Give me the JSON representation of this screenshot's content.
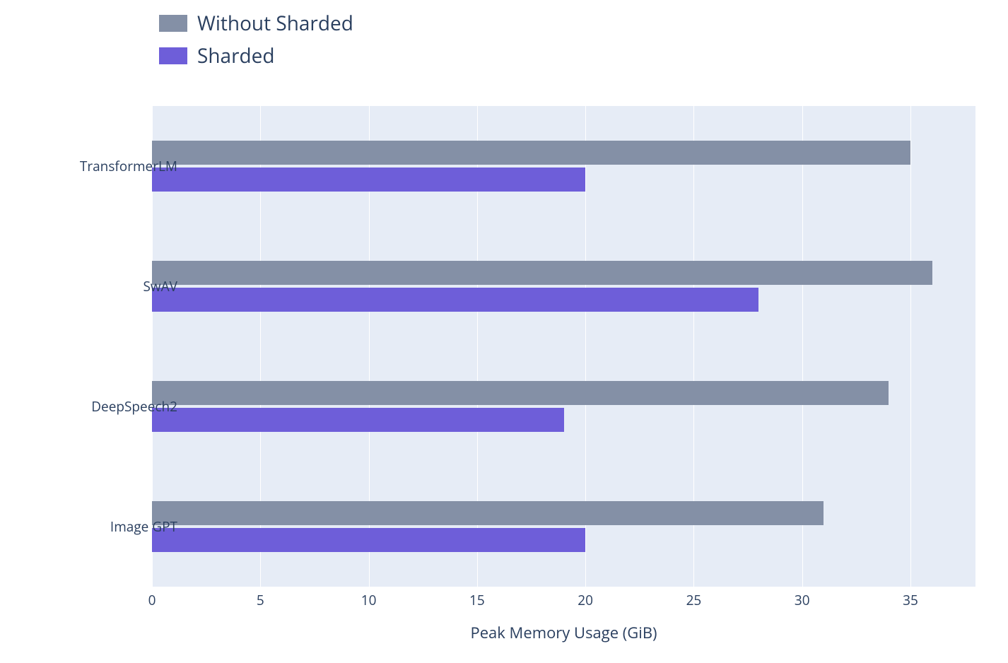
{
  "legend": {
    "items": [
      {
        "label": "Without Sharded",
        "color": "#8490a6"
      },
      {
        "label": "Sharded",
        "color": "#6e5ed9"
      }
    ]
  },
  "chart_data": {
    "type": "bar",
    "orientation": "horizontal",
    "categories": [
      "TransformerLM",
      "SwAV",
      "DeepSpeech2",
      "Image GPT"
    ],
    "series": [
      {
        "name": "Without Sharded",
        "color": "#8490a6",
        "values": [
          35,
          36,
          34,
          31
        ]
      },
      {
        "name": "Sharded",
        "color": "#6e5ed9",
        "values": [
          20,
          28,
          19,
          20
        ]
      }
    ],
    "xlabel": "Peak Memory Usage (GiB)",
    "ylabel": "",
    "xlim": [
      0,
      38
    ],
    "xticks": [
      0,
      5,
      10,
      15,
      20,
      25,
      30,
      35
    ],
    "grid": true,
    "legend_position": "top-left"
  }
}
